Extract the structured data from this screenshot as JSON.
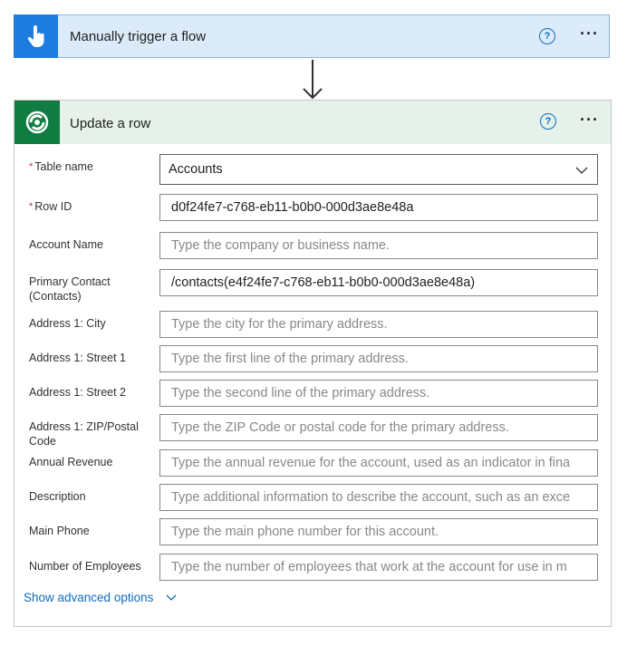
{
  "trigger": {
    "title": "Manually trigger a flow",
    "icon": "hand-tap-icon",
    "accent": "#1e7ce0"
  },
  "action": {
    "title": "Update a row",
    "icon": "dataverse-icon",
    "accent": "#107c41"
  },
  "fields": {
    "table_name": {
      "label": "Table name",
      "required": true,
      "value": "Accounts"
    },
    "row_id": {
      "label": "Row ID",
      "required": true,
      "value": "d0f24fe7-c768-eb11-b0b0-000d3ae8e48a"
    },
    "account_name": {
      "label": "Account Name",
      "placeholder": "Type the company or business name."
    },
    "primary_contact": {
      "label": "Primary Contact (Contacts)",
      "value": "/contacts(e4f24fe7-c768-eb11-b0b0-000d3ae8e48a)"
    },
    "city": {
      "label": "Address 1: City",
      "placeholder": "Type the city for the primary address."
    },
    "street1": {
      "label": "Address 1: Street 1",
      "placeholder": "Type the first line of the primary address."
    },
    "street2": {
      "label": "Address 1: Street 2",
      "placeholder": "Type the second line of the primary address."
    },
    "zip": {
      "label": "Address 1: ZIP/Postal Code",
      "placeholder": "Type the ZIP Code or postal code for the primary address."
    },
    "revenue": {
      "label": "Annual Revenue",
      "placeholder": "Type the annual revenue for the account, used as an indicator in fina"
    },
    "description": {
      "label": "Description",
      "placeholder": "Type additional information to describe the account, such as an exce"
    },
    "phone": {
      "label": "Main Phone",
      "placeholder": "Type the main phone number for this account."
    },
    "employees": {
      "label": "Number of Employees",
      "placeholder": "Type the number of employees that work at the account for use in m"
    }
  },
  "advanced_label": "Show advanced options",
  "required_mark": "*",
  "help_glyph": "?",
  "more_glyph": "···"
}
